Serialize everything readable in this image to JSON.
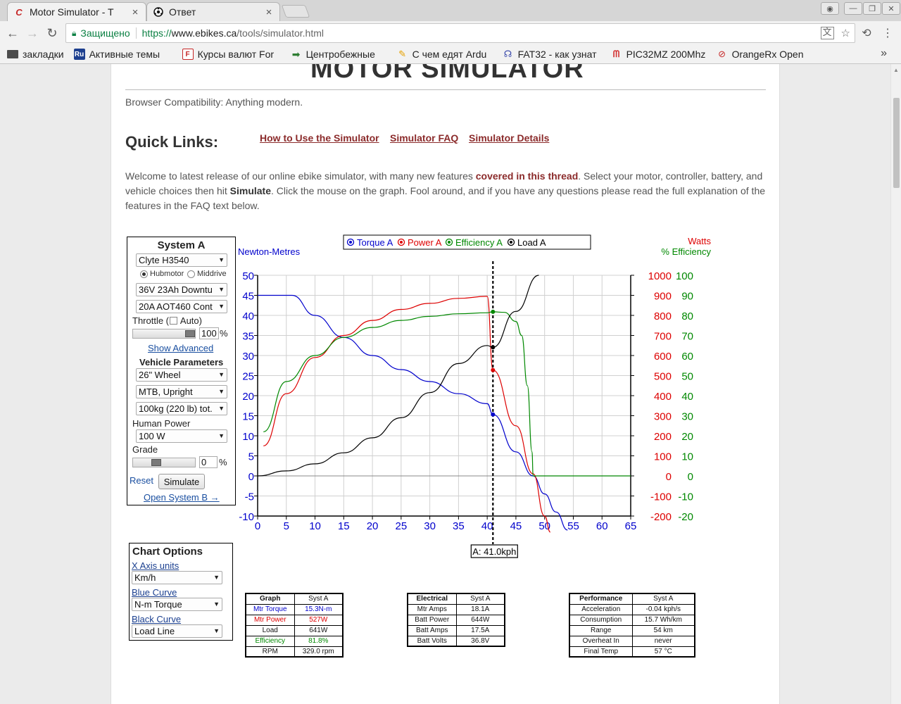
{
  "browser": {
    "tabs": [
      {
        "title": "Motor Simulator - T",
        "icon": "ebikes-logo-icon"
      },
      {
        "title": "Ответ",
        "icon": "soccer-ball-icon"
      }
    ],
    "address": {
      "secure_label": "Защищено",
      "scheme": "https://",
      "host": "www.ebikes.ca",
      "path": "/tools/simulator.html"
    },
    "bookmarks": [
      {
        "label": "закладки",
        "icon": "folder-icon",
        "color": "#555555"
      },
      {
        "label": "Активные темы",
        "icon": "ru-icon",
        "color": "#1d3f8f"
      },
      {
        "label": "Курсы валют For",
        "icon": "fx-icon",
        "color": "#c62828"
      },
      {
        "label": "Центробежные",
        "icon": "arrow-icon",
        "color": "#2e7d32"
      },
      {
        "label": "С чем едят Ardu",
        "icon": "pencil-icon",
        "color": "#e6a100"
      },
      {
        "label": "FAT32 - как узнат",
        "icon": "head-icon",
        "color": "#3949ab"
      },
      {
        "label": "PIC32MZ 200Mhz",
        "icon": "microchip-logo-icon",
        "color": "#d32f2f"
      },
      {
        "label": "OrangeRx Open",
        "icon": "orangerx-icon",
        "color": "#c62828"
      }
    ]
  },
  "page": {
    "title": "MOTOR SIMULATOR",
    "compat": "Browser Compatibility: Anything modern.",
    "quick_links_label": "Quick Links:",
    "quick_links": [
      "How to Use the Simulator",
      "Simulator FAQ",
      "Simulator Details"
    ],
    "welcome": {
      "p1": "Welcome to latest release of our online ebike simulator, with many new features ",
      "thread": "covered in this thread",
      "p2": ".  Select your motor, controller, battery, and vehicle choices then hit ",
      "simulate": "Simulate",
      "p3": ". Click the mouse on the graph. Fool around, and if you have any questions please read the full explanation of the features in the FAQ text below."
    }
  },
  "systemA": {
    "title": "System A",
    "motor": "Clyte H3540",
    "radio_hub": "Hubmotor",
    "radio_mid": "Middrive",
    "battery": "36V 23Ah Downtu",
    "controller": "20A AOT460 Cont",
    "throttle_label": "Throttle (",
    "auto_label": " Auto)",
    "throttle_value": "100",
    "percent": "%",
    "show_advanced": "Show Advanced",
    "vehicle_params": "Vehicle Parameters",
    "wheel": "26\"  Wheel",
    "frame": "MTB, Upright",
    "mass": "100kg (220 lb) tot.",
    "human_power_label": "Human Power",
    "human_power": "100 W",
    "grade_label": "Grade",
    "grade_value": "0",
    "reset": "Reset",
    "simulate": "Simulate",
    "open_b": "Open System B →"
  },
  "chart_options": {
    "title": "Chart Options",
    "x_axis_label": "X Axis units",
    "x_axis_value": "Km/h",
    "blue_label": "Blue Curve",
    "blue_value": "N-m Torque",
    "black_label": "Black Curve",
    "black_value": "Load Line"
  },
  "chart_data": {
    "type": "line",
    "legend": [
      "Torque A",
      "Power A",
      "Efficiency A",
      "Load A"
    ],
    "legend_colors": [
      "#0000cc",
      "#dd0000",
      "#008800",
      "#000000"
    ],
    "left_axis_title": "Newton-Metres",
    "right_axis_title_watts": "Watts",
    "right_axis_title_eff": "% Efficiency",
    "x_ticks": [
      0,
      5,
      10,
      15,
      20,
      25,
      30,
      35,
      40,
      45,
      50,
      55,
      60,
      65
    ],
    "y_ticks": [
      50,
      45,
      40,
      35,
      30,
      25,
      20,
      15,
      10,
      5,
      0,
      -5,
      -10
    ],
    "watts_ticks": [
      1000,
      900,
      800,
      700,
      600,
      500,
      400,
      300,
      200,
      100,
      0,
      -100,
      -200
    ],
    "eff_ticks": [
      100,
      90,
      80,
      70,
      60,
      50,
      40,
      30,
      20,
      10,
      0,
      -10,
      -20
    ],
    "xlim": [
      0,
      65
    ],
    "ylim": [
      -10,
      50
    ],
    "grid": true,
    "cursor_x": 41.0,
    "cursor_label": "A: 41.0kph",
    "series": [
      {
        "name": "Torque A",
        "color": "#0000cc",
        "axis": "nm",
        "x": [
          0,
          6,
          10,
          15,
          20,
          25,
          30,
          35,
          40,
          41,
          45,
          48,
          50,
          52,
          54
        ],
        "y": [
          45,
          45,
          40,
          34.5,
          30,
          26.5,
          23.5,
          20.5,
          18,
          15.3,
          6,
          0,
          -4.5,
          -9,
          -13.5
        ]
      },
      {
        "name": "Power A",
        "color": "#dd0000",
        "axis": "watts",
        "x": [
          1,
          5,
          10,
          15,
          20,
          25,
          30,
          35,
          40,
          41,
          45,
          48,
          50,
          51
        ],
        "y": [
          150,
          410,
          590,
          700,
          775,
          830,
          860,
          885,
          895,
          527,
          250,
          10,
          -200,
          -280
        ]
      },
      {
        "name": "Efficiency A",
        "color": "#008800",
        "axis": "eff",
        "x": [
          1,
          5,
          10,
          15,
          20,
          25,
          30,
          35,
          40,
          41,
          43,
          45,
          46,
          47,
          47.8,
          48,
          50,
          65
        ],
        "y": [
          22,
          47,
          60,
          69,
          74,
          77.5,
          79.5,
          80.8,
          81.3,
          81.8,
          81.5,
          77,
          70,
          45,
          12,
          0,
          0,
          0
        ]
      },
      {
        "name": "Load A",
        "color": "#000000",
        "axis": "watts",
        "x": [
          0,
          5,
          10,
          15,
          20,
          25,
          30,
          35,
          40,
          41,
          45,
          49
        ],
        "y": [
          0,
          25,
          60,
          115,
          190,
          290,
          415,
          560,
          650,
          641,
          820,
          1000
        ]
      }
    ],
    "markers": [
      {
        "series": "Efficiency A",
        "x": 41,
        "y": 81.8,
        "axis": "eff",
        "color": "#008800"
      },
      {
        "series": "Load A",
        "x": 41,
        "y": 641,
        "axis": "watts",
        "color": "#000000"
      },
      {
        "series": "Power A",
        "x": 41,
        "y": 527,
        "axis": "watts",
        "color": "#dd0000"
      },
      {
        "series": "Torque A",
        "x": 41,
        "y": 15.3,
        "axis": "nm",
        "color": "#0000cc"
      }
    ]
  },
  "tables": {
    "graph": {
      "headers": [
        "Graph",
        "Syst A"
      ],
      "rows": [
        {
          "k": "Mtr Torque",
          "v": "15.3N-m",
          "color": "#0000cc"
        },
        {
          "k": "Mtr Power",
          "v": "527W",
          "color": "#dd0000"
        },
        {
          "k": "Load",
          "v": "641W",
          "color": "#111111"
        },
        {
          "k": "Efficiency",
          "v": "81.8%",
          "color": "#008800"
        },
        {
          "k": "RPM",
          "v": "329.0 rpm",
          "color": "#111111"
        }
      ]
    },
    "electrical": {
      "headers": [
        "Electrical",
        "Syst A"
      ],
      "rows": [
        {
          "k": "Mtr Amps",
          "v": "18.1A"
        },
        {
          "k": "Batt Power",
          "v": "644W"
        },
        {
          "k": "Batt Amps",
          "v": "17.5A"
        },
        {
          "k": "Batt Volts",
          "v": "36.8V"
        }
      ]
    },
    "performance": {
      "headers": [
        "Performance",
        "Syst A"
      ],
      "rows": [
        {
          "k": "Acceleration",
          "v": "-0.04 kph/s"
        },
        {
          "k": "Consumption",
          "v": "15.7 Wh/km"
        },
        {
          "k": "Range",
          "v": "54 km"
        },
        {
          "k": "Overheat In",
          "v": "never"
        },
        {
          "k": "Final Temp",
          "v": "57 °C"
        }
      ]
    }
  }
}
